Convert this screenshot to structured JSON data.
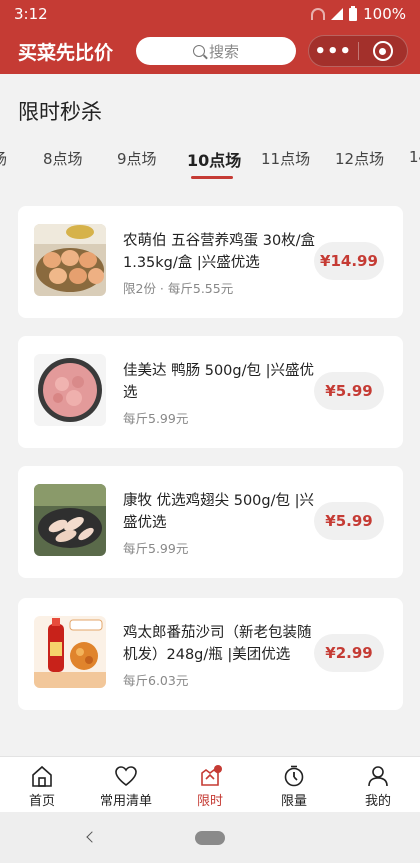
{
  "status_bar": {
    "time": "3:12",
    "battery": "100%"
  },
  "header": {
    "title": "买菜先比价",
    "search_placeholder": "搜索",
    "more_label": "•••"
  },
  "page": {
    "title": "限时秒杀",
    "tabs": [
      {
        "label": "场"
      },
      {
        "label": "8点场"
      },
      {
        "label": "9点场"
      },
      {
        "label": "10点场"
      },
      {
        "label": "11点场"
      },
      {
        "label": "12点场"
      },
      {
        "label": "14"
      }
    ],
    "active_tab": "10点场"
  },
  "products": [
    {
      "name": "农萌伯 五谷营养鸡蛋 30枚/盒 1.35kg/盒 |兴盛优选",
      "meta": "限2份 · 每斤5.55元",
      "price": "¥14.99"
    },
    {
      "name": "佳美达 鸭肠 500g/包 |兴盛优选",
      "meta": "每斤5.99元",
      "price": "¥5.99"
    },
    {
      "name": "康牧 优选鸡翅尖 500g/包 |兴盛优选",
      "meta": "每斤5.99元",
      "price": "¥5.99"
    },
    {
      "name": "鸡太郎番茄沙司（新老包装随机发）248g/瓶 |美团优选",
      "meta": "每斤6.03元",
      "price": "¥2.99"
    }
  ],
  "tabbar": [
    {
      "label": "首页",
      "icon": "home-icon"
    },
    {
      "label": "常用清单",
      "icon": "heart-icon"
    },
    {
      "label": "限时",
      "icon": "flash-sale-icon"
    },
    {
      "label": "限量",
      "icon": "timer-icon"
    },
    {
      "label": "我的",
      "icon": "person-icon"
    }
  ],
  "colors": {
    "brand": "#c53b34",
    "background": "#f2f2f2"
  }
}
